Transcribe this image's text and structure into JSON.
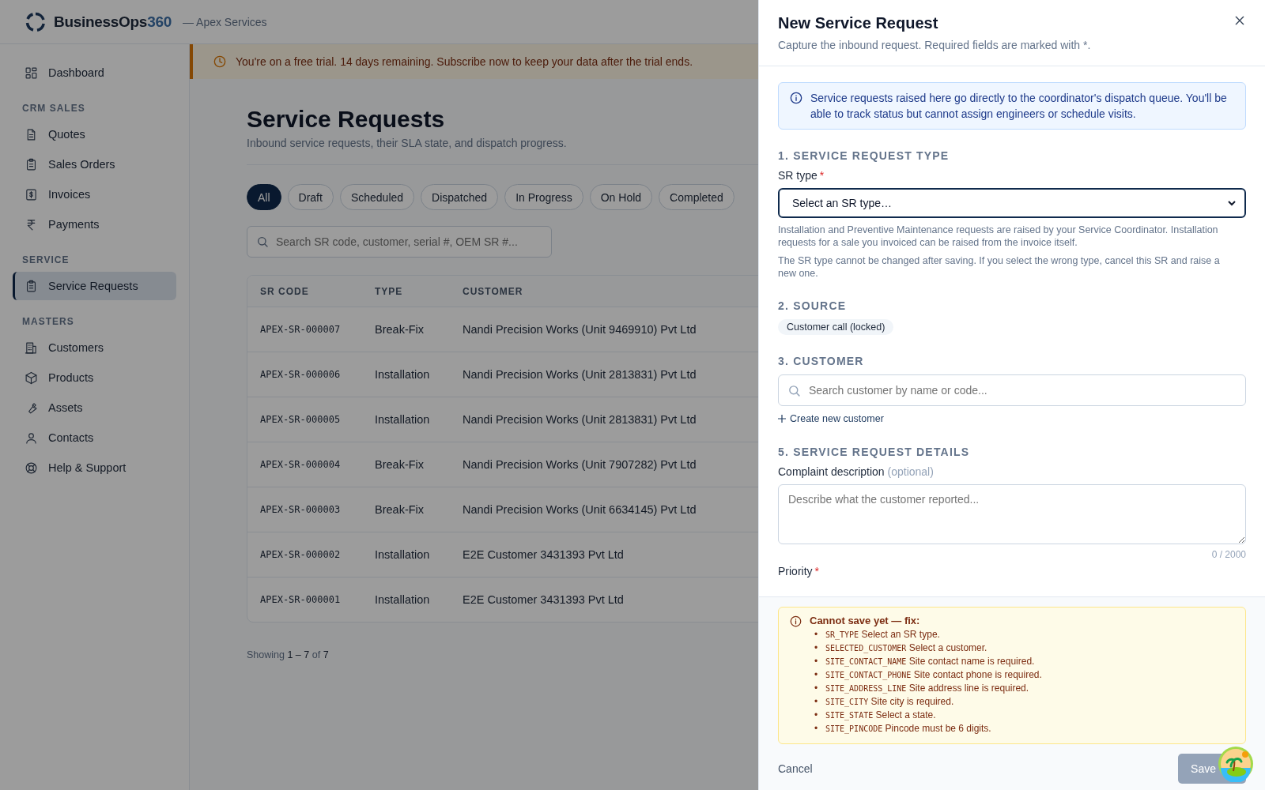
{
  "header": {
    "brand_name": "BusinessOps",
    "brand_number": "360",
    "tenant": "— Apex Services"
  },
  "sidebar": {
    "sections": [
      {
        "items": [
          {
            "label": "Dashboard",
            "selected": false
          }
        ]
      },
      {
        "heading": "CRM SALES",
        "items": [
          {
            "label": "Quotes",
            "selected": false
          },
          {
            "label": "Sales Orders",
            "selected": false
          },
          {
            "label": "Invoices",
            "selected": false
          },
          {
            "label": "Payments",
            "selected": false
          }
        ]
      },
      {
        "heading": "SERVICE",
        "items": [
          {
            "label": "Service Requests",
            "selected": true
          }
        ]
      },
      {
        "heading": "MASTERS",
        "items": [
          {
            "label": "Customers",
            "selected": false
          },
          {
            "label": "Products",
            "selected": false
          },
          {
            "label": "Assets",
            "selected": false
          },
          {
            "label": "Contacts",
            "selected": false
          },
          {
            "label": "Help & Support",
            "selected": false
          }
        ]
      }
    ]
  },
  "trial_banner": {
    "text": "You're on a free trial. 14 days remaining. Subscribe now to keep your data after the trial ends."
  },
  "page": {
    "title": "Service Requests",
    "subtitle": "Inbound service requests, their SLA state, and dispatch progress."
  },
  "filters": [
    {
      "label": "All",
      "selected": true
    },
    {
      "label": "Draft",
      "selected": false
    },
    {
      "label": "Scheduled",
      "selected": false
    },
    {
      "label": "Dispatched",
      "selected": false
    },
    {
      "label": "In Progress",
      "selected": false
    },
    {
      "label": "On Hold",
      "selected": false
    },
    {
      "label": "Completed",
      "selected": false
    }
  ],
  "search": {
    "placeholder": "Search SR code, customer, serial #, OEM SR #..."
  },
  "table": {
    "columns": [
      "SR CODE",
      "TYPE",
      "CUSTOMER"
    ],
    "rows": [
      [
        "APEX-SR-000007",
        "Break-Fix",
        "Nandi Precision Works (Unit 9469910) Pvt Ltd"
      ],
      [
        "APEX-SR-000006",
        "Installation",
        "Nandi Precision Works (Unit 2813831) Pvt Ltd"
      ],
      [
        "APEX-SR-000005",
        "Installation",
        "Nandi Precision Works (Unit 2813831) Pvt Ltd"
      ],
      [
        "APEX-SR-000004",
        "Break-Fix",
        "Nandi Precision Works (Unit 7907282) Pvt Ltd"
      ],
      [
        "APEX-SR-000003",
        "Break-Fix",
        "Nandi Precision Works (Unit 6634145) Pvt Ltd"
      ],
      [
        "APEX-SR-000002",
        "Installation",
        "E2E Customer 3431393 Pvt Ltd"
      ],
      [
        "APEX-SR-000001",
        "Installation",
        "E2E Customer 3431393 Pvt Ltd"
      ]
    ]
  },
  "pagination": "Showing **1 – 7** of **7**",
  "drawer": {
    "title": "New Service Request",
    "subtitle": "Capture the inbound request. Required fields are marked with *.",
    "notice": "Service requests raised here go directly to the coordinator's dispatch queue. You'll be able to track status but cannot assign engineers or schedule visits.",
    "sr_type": {
      "heading": "1. SERVICE REQUEST TYPE",
      "label": "SR type",
      "required_mark": "*",
      "value": "Select an SR type…",
      "hints": [
        "Installation and Preventive Maintenance requests are raised by your Service Coordinator. Installation requests for a sale you invoiced can be raised from the invoice itself.",
        "The SR type cannot be changed after saving. If you select the wrong type, cancel this SR and raise a new one."
      ]
    },
    "source": {
      "heading": "2. SOURCE",
      "chip": "Customer call (locked)"
    },
    "customer": {
      "heading": "3. CUSTOMER",
      "placeholder": "Search customer by name or code...",
      "create_link": "Create new customer"
    },
    "details": {
      "heading": "5. SERVICE REQUEST DETAILS",
      "complaint_label": "Complaint description",
      "optional_note": "(optional)",
      "placeholder": "Describe what the customer reported...",
      "counter": "0 / 2000",
      "priority_label": "Priority",
      "priority_required_mark": "*"
    },
    "errors": {
      "title": "Cannot save yet — fix:",
      "items": [
        {
          "marker": "•",
          "code": "SR_TYPE",
          "message": "Select an SR type."
        },
        {
          "marker": "•",
          "code": "SELECTED_CUSTOMER",
          "message": "Select a customer."
        },
        {
          "marker": "•",
          "code": "SITE_CONTACT_NAME",
          "message": "Site contact name is required."
        },
        {
          "marker": "•",
          "code": "SITE_CONTACT_PHONE",
          "message": "Site contact phone is required."
        },
        {
          "marker": "•",
          "code": "SITE_ADDRESS_LINE",
          "message": "Site address line is required."
        },
        {
          "marker": "•",
          "code": "SITE_CITY",
          "message": "Site city is required."
        },
        {
          "marker": "•",
          "code": "SITE_STATE",
          "message": "Select a state."
        },
        {
          "marker": "•",
          "code": "SITE_PINCODE",
          "message": "Pincode must be 6 digits."
        }
      ]
    },
    "cancel": "Cancel",
    "save": "Save",
    "save_disabled": true
  }
}
